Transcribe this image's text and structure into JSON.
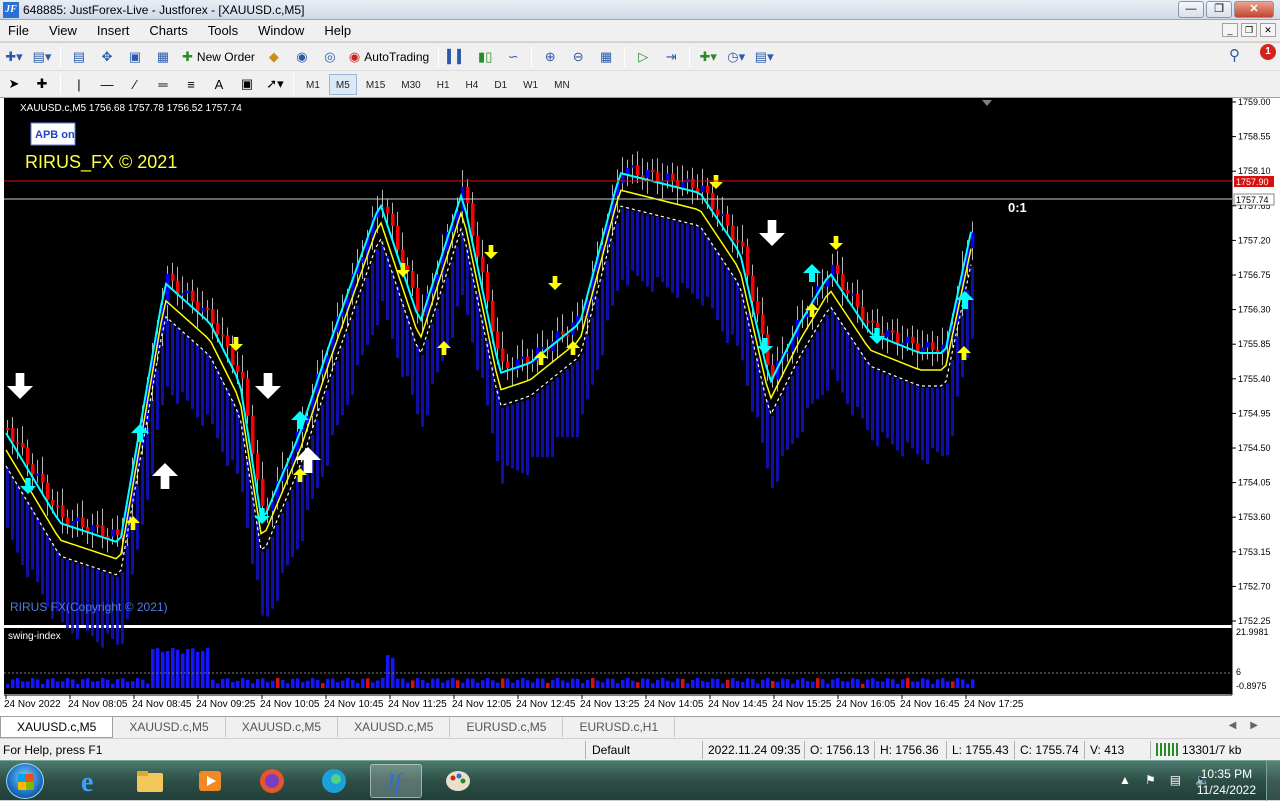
{
  "window": {
    "title": "648885: JustForex-Live - Justforex - [XAUUSD.c,M5]",
    "logo": "JF"
  },
  "menu": [
    "File",
    "View",
    "Insert",
    "Charts",
    "Tools",
    "Window",
    "Help"
  ],
  "toolbar": {
    "new_order": "New Order",
    "auto_trading": "AutoTrading",
    "notification_count": "1"
  },
  "timeframes": [
    "M1",
    "M5",
    "M15",
    "M30",
    "H1",
    "H4",
    "D1",
    "W1",
    "MN"
  ],
  "active_timeframe": "M5",
  "chart": {
    "header": "XAUUSD.c,M5  1756.68 1757.78 1756.52 1757.74",
    "apb_badge": "APB on",
    "watermark": "RIRUS_FX © 2021",
    "copyright": "RIRUS FX(Copyright © 2021)",
    "ratio_label": "0:1",
    "bid_price": "1757.74",
    "line_price": "1757.90",
    "price_ticks": [
      "1759.00",
      "1758.55",
      "1758.10",
      "1757.65",
      "1757.20",
      "1756.75",
      "1756.30",
      "1755.85",
      "1755.40",
      "1754.95",
      "1754.50",
      "1754.05",
      "1753.60",
      "1753.15",
      "1752.70",
      "1752.25"
    ],
    "time_ticks": [
      "24 Nov 2022",
      "24 Nov 08:05",
      "24 Nov 08:45",
      "24 Nov 09:25",
      "24 Nov 10:05",
      "24 Nov 10:45",
      "24 Nov 11:25",
      "24 Nov 12:05",
      "24 Nov 12:45",
      "24 Nov 13:25",
      "24 Nov 14:05",
      "24 Nov 14:45",
      "24 Nov 15:25",
      "24 Nov 16:05",
      "24 Nov 16:45",
      "24 Nov 17:25"
    ],
    "indicator_label": "swing-index",
    "indicator_ticks": [
      "21.9981",
      "6",
      "-0.8975"
    ],
    "colors": {
      "bull": "#0000ff",
      "bear": "#ff0000",
      "ma_yellow": "#ffff00",
      "ma_cyan": "#00ffff",
      "arrow_white": "#ffffff",
      "background": "#000000"
    }
  },
  "tabs": [
    "XAUUSD.c,M5",
    "XAUUSD.c,M5",
    "XAUUSD.c,M5",
    "XAUUSD.c,M5",
    "EURUSD.c,M5",
    "EURUSD.c,H1"
  ],
  "active_tab": 0,
  "status": {
    "help": "For Help, press F1",
    "profile": "Default",
    "time": "2022.11.24 09:35",
    "open": "O: 1756.13",
    "high": "H: 1756.36",
    "low": "L: 1755.43",
    "close": "C: 1755.74",
    "volume": "V: 413",
    "traffic": "13301/7 kb"
  },
  "taskbar": {
    "clock_time": "10:35 PM",
    "clock_date": "11/24/2022"
  }
}
